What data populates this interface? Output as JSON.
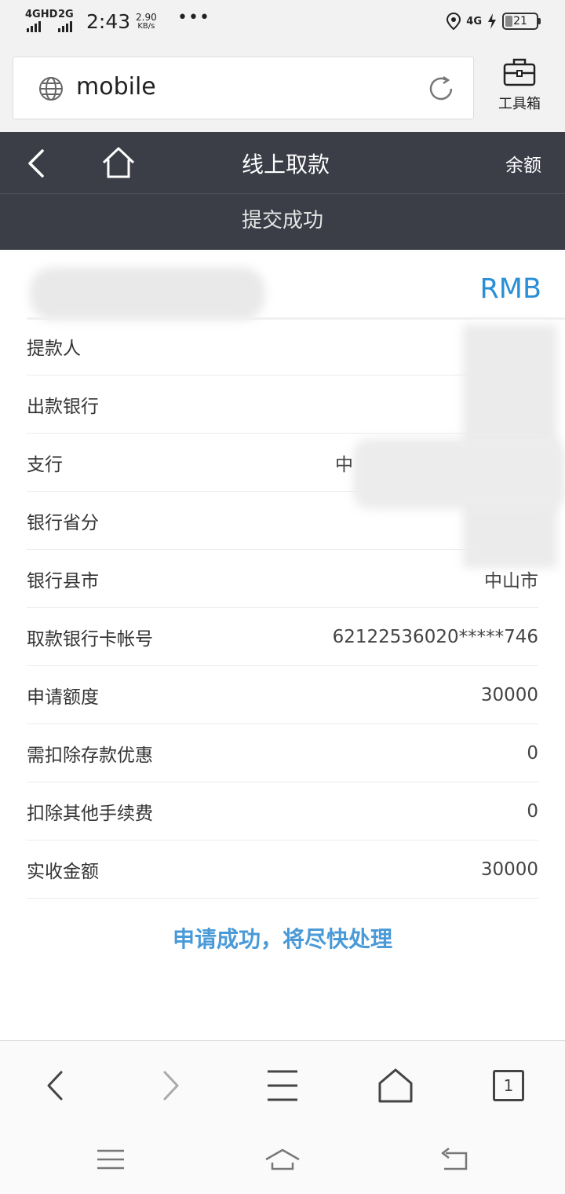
{
  "status_bar": {
    "network1": "4GHD",
    "network2": "2G",
    "time": "2:43",
    "speed_value": "2.90",
    "speed_unit": "KB/s",
    "more": "•••",
    "right_network": "4G",
    "battery": "21"
  },
  "browser": {
    "url": "mobile",
    "toolbox_label": "工具箱"
  },
  "header": {
    "title": "线上取款",
    "balance_label": "余额",
    "subtitle": "提交成功"
  },
  "content": {
    "currency": "RMB",
    "rows": [
      {
        "label": "提款人",
        "value": ""
      },
      {
        "label": "出款银行",
        "value": ""
      },
      {
        "label": "支行",
        "value": "中"
      },
      {
        "label": "银行省分",
        "value": ""
      },
      {
        "label": "银行县市",
        "value": "中山市"
      },
      {
        "label": "取款银行卡帐号",
        "value": "62122536020*****746"
      },
      {
        "label": "申请额度",
        "value": "30000"
      },
      {
        "label": "需扣除存款优惠",
        "value": "0"
      },
      {
        "label": "扣除其他手续费",
        "value": "0"
      },
      {
        "label": "实收金额",
        "value": "30000"
      }
    ],
    "success_message": "申请成功，将尽快处理"
  },
  "bottom_nav": {
    "tab_count": "1"
  },
  "colors": {
    "header_bg": "#3b3d47",
    "accent": "#2a8fd6",
    "success_text": "#4a9ad8"
  },
  "icons": [
    "globe-icon",
    "reload-icon",
    "toolbox-icon",
    "back-icon",
    "home-icon",
    "nav-back-icon",
    "nav-forward-icon",
    "menu-icon",
    "nav-home-icon",
    "tabs-icon",
    "sys-menu-icon",
    "sys-home-icon",
    "sys-back-icon",
    "location-icon",
    "charging-icon",
    "battery-icon"
  ]
}
